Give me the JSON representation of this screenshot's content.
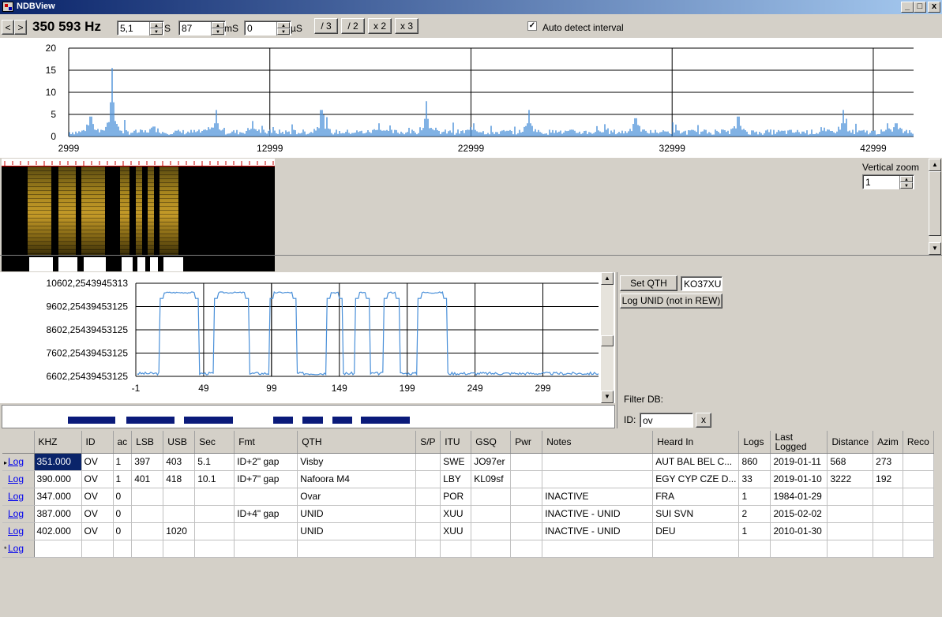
{
  "window": {
    "title": "NDBView",
    "minimize": "_",
    "maximize": "□",
    "close": "x"
  },
  "toolbar": {
    "prev": "<",
    "next": ">",
    "frequency": "350 593 Hz",
    "seconds_value": "5,1",
    "seconds_unit": "S",
    "ms_value": "87",
    "ms_unit": "mS",
    "us_value": "0",
    "us_unit": "µS",
    "div3": "/ 3",
    "div2": "/ 2",
    "mul2": "x 2",
    "mul3": "x 3",
    "auto_detect_label": "Auto detect interval",
    "auto_detect_checked": true
  },
  "spectrum": {
    "y_ticks": [
      "20",
      "15",
      "10",
      "5",
      "0"
    ],
    "x_ticks": [
      "2999",
      "12999",
      "22999",
      "32999",
      "42999"
    ],
    "color": "#4a90d9"
  },
  "waterfall": {
    "vertical_zoom_label": "Vertical zoom",
    "vertical_zoom_value": "1"
  },
  "timeplot": {
    "chart_data": {
      "type": "line",
      "y_ticks": [
        "10602,2543945313",
        "9602,25439453125",
        "8602,25439453125",
        "7602,25439453125",
        "6602,25439453125"
      ],
      "x_ticks": [
        "-1",
        "49",
        "99",
        "149",
        "199",
        "249",
        "299"
      ],
      "xlim": [
        -1,
        340
      ],
      "ylim": [
        6602.25439453125,
        10602.2543945313
      ],
      "series": [
        {
          "segments_high": [
            [
              17,
              45
            ],
            [
              57,
              82
            ],
            [
              98,
              117
            ],
            [
              140,
              151
            ],
            [
              161,
              171
            ],
            [
              182,
              193
            ],
            [
              207,
              228
            ]
          ],
          "high": 10202,
          "low": 6702
        }
      ]
    }
  },
  "morse": {
    "blocks": [
      [
        83,
        60
      ],
      [
        157,
        61
      ],
      [
        230,
        62
      ],
      [
        343,
        25
      ],
      [
        380,
        26
      ],
      [
        418,
        25
      ],
      [
        454,
        62
      ]
    ]
  },
  "side": {
    "set_qth": "Set QTH",
    "qth_value": "KO37XU",
    "log_unid": "Log UNID (not in REW)",
    "filter_label": "Filter DB:",
    "id_label": "ID:",
    "id_value": "ov",
    "clear": "x"
  },
  "grid": {
    "columns": [
      "KHZ",
      "ID",
      "ac",
      "LSB",
      "USB",
      "Sec",
      "Fmt",
      "QTH",
      "S/P",
      "ITU",
      "GSQ",
      "Pwr",
      "Notes",
      "Heard In",
      "Logs",
      "Last\nLogged",
      "Distance",
      "Azim",
      "Reco"
    ],
    "log_label": "Log",
    "rows": [
      [
        "351.000",
        "OV",
        "1",
        "397",
        "403",
        "5.1",
        "ID+2\" gap",
        "Visby",
        "",
        "SWE",
        "JO97er",
        "",
        "",
        "AUT BAL BEL C...",
        "860",
        "2019-01-11",
        "568",
        "273",
        ""
      ],
      [
        "390.000",
        "OV",
        "1",
        "401",
        "418",
        "10.1",
        "ID+7\" gap",
        "Nafoora M4",
        "",
        "LBY",
        "KL09sf",
        "",
        "",
        "EGY CYP CZE D...",
        "33",
        "2019-01-10",
        "3222",
        "192",
        ""
      ],
      [
        "347.000",
        "OV",
        "0",
        "",
        "",
        "",
        "",
        "Ovar",
        "",
        "POR",
        "",
        "",
        "INACTIVE",
        "FRA",
        "1",
        "1984-01-29",
        "",
        "",
        ""
      ],
      [
        "387.000",
        "OV",
        "0",
        "",
        "",
        "",
        "ID+4\" gap",
        "UNID",
        "",
        "XUU",
        "",
        "",
        "INACTIVE - UNID",
        "SUI SVN",
        "2",
        "2015-02-02",
        "",
        "",
        ""
      ],
      [
        "402.000",
        "OV",
        "0",
        "",
        "1020",
        "",
        "",
        "UNID",
        "",
        "XUU",
        "",
        "",
        "INACTIVE - UNID",
        "DEU",
        "1",
        "2010-01-30",
        "",
        "",
        ""
      ]
    ]
  }
}
